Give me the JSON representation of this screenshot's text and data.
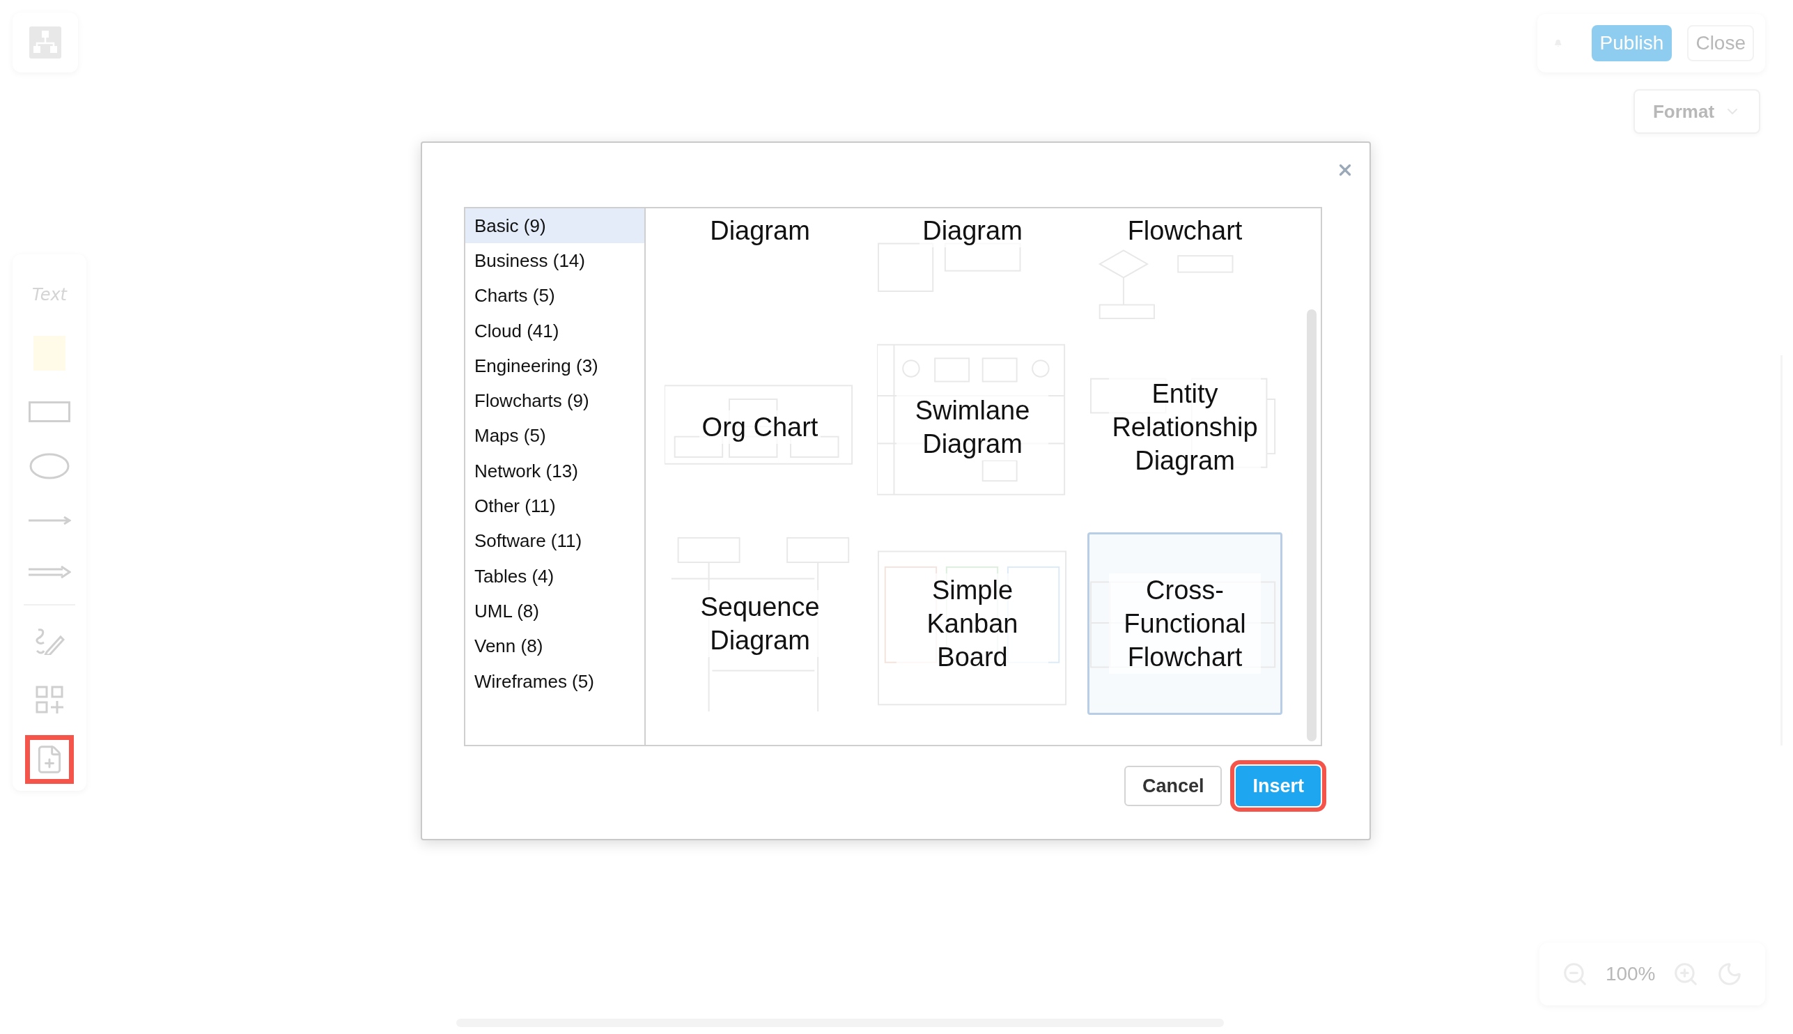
{
  "toolbar": {
    "items": [
      {
        "kind": "text",
        "label": "Text",
        "highlighted": false
      },
      {
        "kind": "note",
        "highlighted": false
      },
      {
        "kind": "rect",
        "highlighted": false
      },
      {
        "kind": "ellipse",
        "highlighted": false
      },
      {
        "kind": "line",
        "highlighted": false
      },
      {
        "kind": "arrow",
        "highlighted": false
      },
      {
        "kind": "draw",
        "highlighted": false
      },
      {
        "kind": "shapes",
        "highlighted": false
      },
      {
        "kind": "template",
        "highlighted": true
      }
    ]
  },
  "header": {
    "publish": "Publish",
    "close": "Close",
    "format": "Format"
  },
  "zoom": {
    "reading": "100%"
  },
  "dialog": {
    "categories": [
      {
        "label": "Basic (9)",
        "selected": true
      },
      {
        "label": "Business (14)",
        "selected": false
      },
      {
        "label": "Charts (5)",
        "selected": false
      },
      {
        "label": "Cloud (41)",
        "selected": false
      },
      {
        "label": "Engineering (3)",
        "selected": false
      },
      {
        "label": "Flowcharts (9)",
        "selected": false
      },
      {
        "label": "Maps (5)",
        "selected": false
      },
      {
        "label": "Network (13)",
        "selected": false
      },
      {
        "label": "Other (11)",
        "selected": false
      },
      {
        "label": "Software (11)",
        "selected": false
      },
      {
        "label": "Tables (4)",
        "selected": false
      },
      {
        "label": "UML (8)",
        "selected": false
      },
      {
        "label": "Venn (8)",
        "selected": false
      },
      {
        "label": "Wireframes (5)",
        "selected": false
      }
    ],
    "templates": [
      {
        "title": "Diagram",
        "kind": "blank",
        "selected": false
      },
      {
        "title": "Diagram",
        "kind": "table",
        "selected": false
      },
      {
        "title": "Flowchart",
        "kind": "flow",
        "selected": false
      },
      {
        "title": "Org Chart",
        "kind": "org",
        "selected": false
      },
      {
        "title": "Swimlane Diagram",
        "kind": "swimlane",
        "selected": false
      },
      {
        "title": "Entity Relationship Diagram",
        "kind": "er",
        "selected": false
      },
      {
        "title": "Sequence Diagram",
        "kind": "sequence",
        "selected": false
      },
      {
        "title": "Simple Kanban Board",
        "kind": "kanban",
        "selected": false
      },
      {
        "title": "Cross-Functional Flowchart",
        "kind": "cross",
        "selected": true
      }
    ],
    "buttons": [
      {
        "label": "Cancel",
        "kind": "secondary",
        "highlighted": false
      },
      {
        "label": "Insert",
        "kind": "primary",
        "highlighted": true
      }
    ]
  }
}
